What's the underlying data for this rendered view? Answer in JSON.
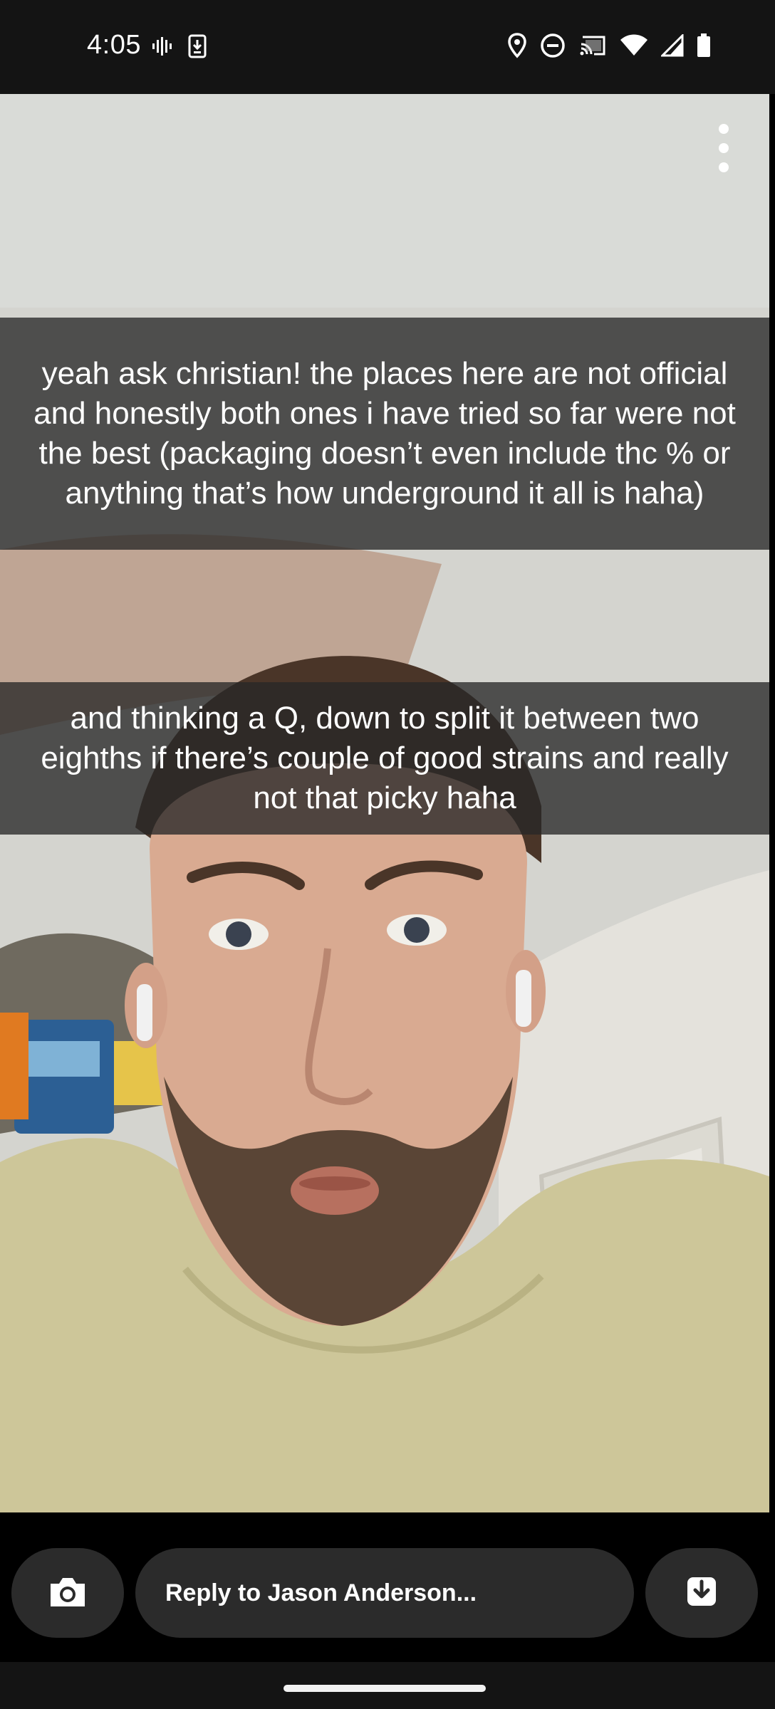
{
  "status_bar": {
    "time": "4:05",
    "left_icons": [
      "voicemail-icon",
      "download-icon"
    ],
    "right_icons": [
      "location-icon",
      "do-not-disturb-icon",
      "cast-icon",
      "wifi-icon",
      "cell-signal-icon",
      "battery-icon"
    ]
  },
  "snap": {
    "menu_icon": "more-vertical-icon",
    "captions": [
      "yeah ask christian! the places here are not official and honestly both ones i have tried so far were not the best (packaging doesn’t even include thc % or anything that’s how underground it all is haha)",
      "and thinking a Q, down to split it between two eighths if there’s couple of good strains and really not that picky haha"
    ]
  },
  "reply_bar": {
    "camera_icon": "camera-icon",
    "reply_placeholder": "Reply to Jason Anderson...",
    "save_icon": "save-download-icon"
  },
  "colors": {
    "status_bar_bg": "#141414",
    "caption_bg": "#282828",
    "pill_button_bg": "#2b2b2b",
    "text": "#ffffff"
  }
}
